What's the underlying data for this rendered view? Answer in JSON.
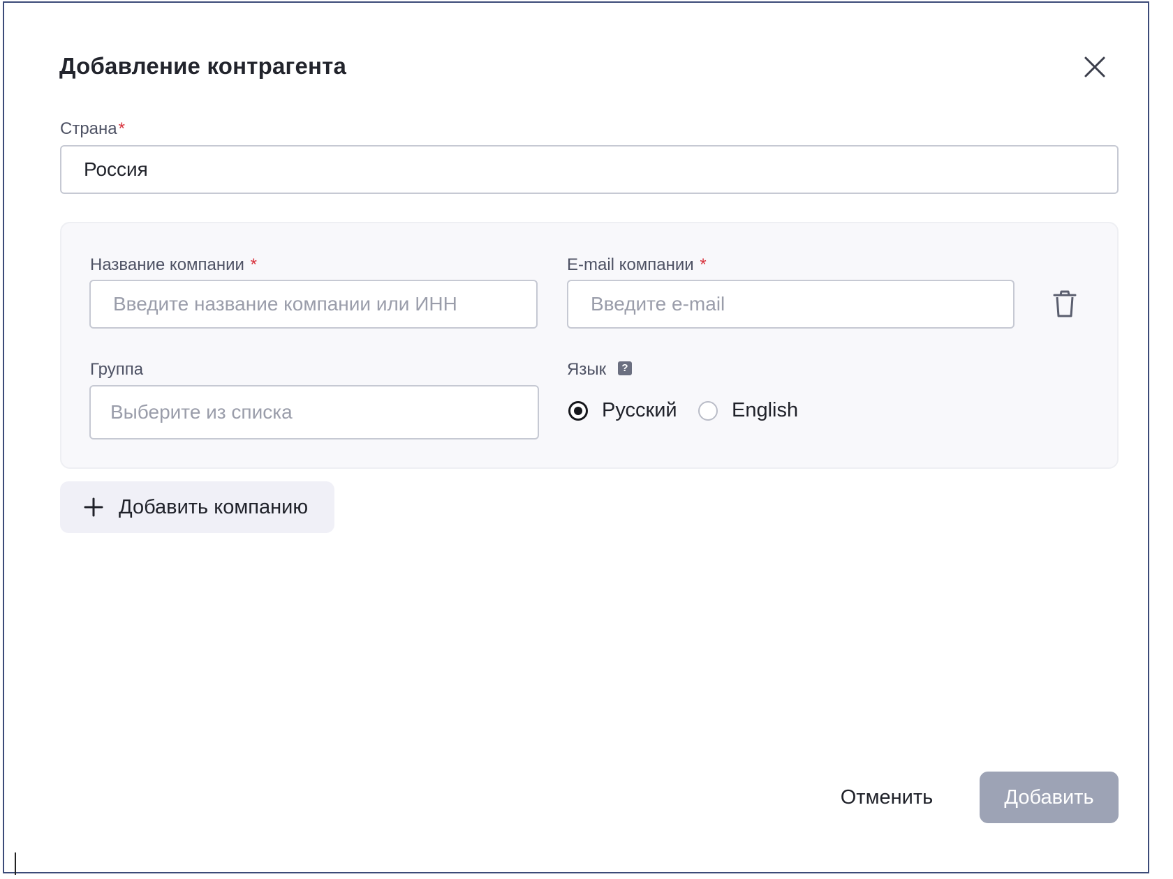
{
  "dialog": {
    "title": "Добавление контрагента",
    "close_icon": "close-icon"
  },
  "country": {
    "label": "Страна",
    "required_mark": "*",
    "value": "Россия"
  },
  "company": {
    "name_label": "Название компании",
    "name_required_mark": "*",
    "name_placeholder": "Введите название компании или ИНН",
    "email_label": "E-mail компании",
    "email_required_mark": "*",
    "email_placeholder": "Введите e-mail",
    "delete_icon": "trash-icon",
    "group_label": "Группа",
    "group_placeholder": "Выберите из списка",
    "language_label": "Язык",
    "language_help_icon": "help-icon",
    "language_help_glyph": "?",
    "language_options": [
      {
        "label": "Русский",
        "selected": true
      },
      {
        "label": "English",
        "selected": false
      }
    ]
  },
  "add_company": {
    "label": "Добавить компанию",
    "icon": "plus-icon"
  },
  "footer": {
    "cancel_label": "Отменить",
    "submit_label": "Добавить"
  },
  "colors": {
    "required": "#d8323c",
    "submit_disabled": "#9da3b5",
    "card_background": "#f8f8fb",
    "add_button_background": "#f0f0f7"
  }
}
